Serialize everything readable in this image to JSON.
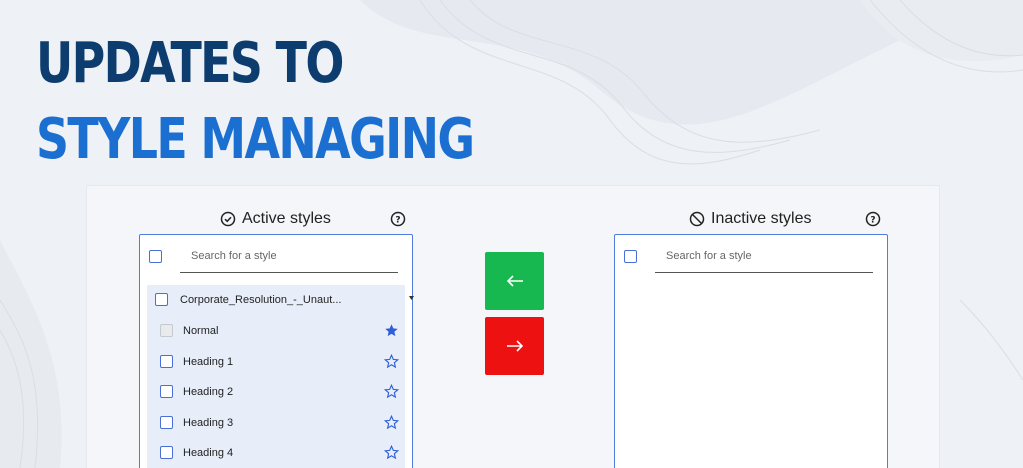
{
  "title": {
    "line1": "UPDATES TO",
    "line2": "STYLE MANAGING"
  },
  "active": {
    "heading": "Active styles",
    "search_placeholder": "Search for a style",
    "group_name": "Corporate_Resolution_-_Unaut...",
    "styles": [
      {
        "label": "Normal",
        "starred": true,
        "checkbox_disabled": true
      },
      {
        "label": "Heading 1",
        "starred": false,
        "checkbox_disabled": false
      },
      {
        "label": "Heading 2",
        "starred": false,
        "checkbox_disabled": false
      },
      {
        "label": "Heading 3",
        "starred": false,
        "checkbox_disabled": false
      },
      {
        "label": "Heading 4",
        "starred": false,
        "checkbox_disabled": false
      }
    ]
  },
  "inactive": {
    "heading": "Inactive styles",
    "search_placeholder": "Search for a style"
  },
  "actions": {
    "move_left_color": "#16b84f",
    "move_right_color": "#ee1111"
  },
  "colors": {
    "title_dark": "#0d3d6e",
    "title_accent": "#1a6fd1",
    "accent": "#4a6fd8"
  }
}
